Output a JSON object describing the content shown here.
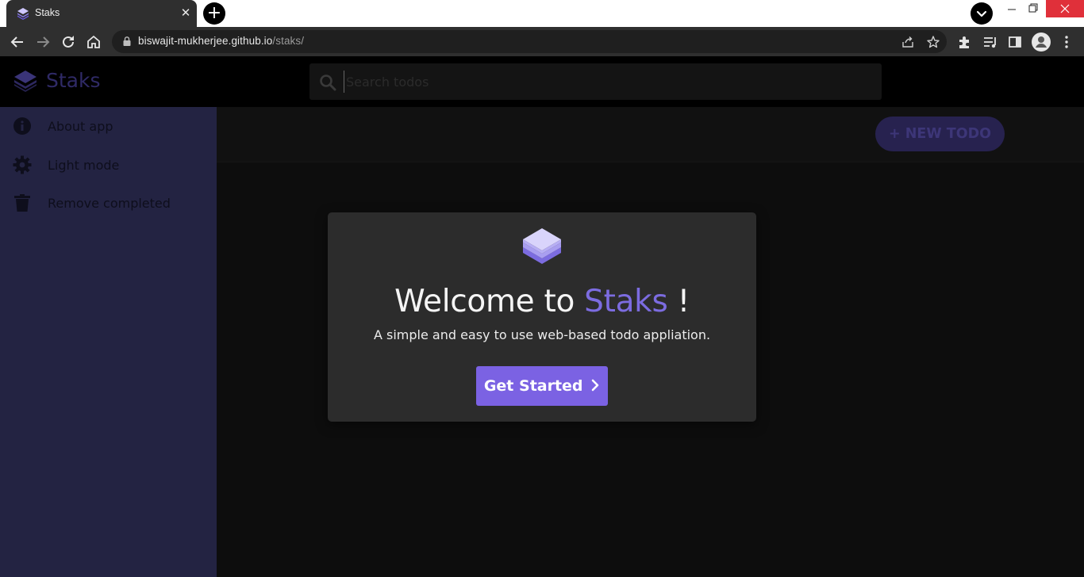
{
  "browser": {
    "tab_title": "Staks",
    "tab_close": "✕",
    "new_tab": "+",
    "url_host": "biswajit-mukherjee.github.io",
    "url_path": "/staks/"
  },
  "app": {
    "brand": "Staks",
    "search": {
      "placeholder": "Search todos"
    },
    "sidebar": {
      "items": [
        {
          "label": "About app",
          "icon": "info-icon"
        },
        {
          "label": "Light mode",
          "icon": "gear-icon"
        },
        {
          "label": "Remove completed",
          "icon": "trash-icon"
        }
      ]
    },
    "new_todo_label": "+ NEW TODO",
    "modal": {
      "welcome_prefix": "Welcome to ",
      "welcome_accent": "Staks",
      "welcome_suffix": " !",
      "subtitle": "A simple and easy to use web-based todo appliation.",
      "cta_label": "Get Started"
    }
  },
  "colors": {
    "accent": "#7b62e3",
    "sidebar_bg": "#232342",
    "modal_bg": "#2c2c2c"
  }
}
